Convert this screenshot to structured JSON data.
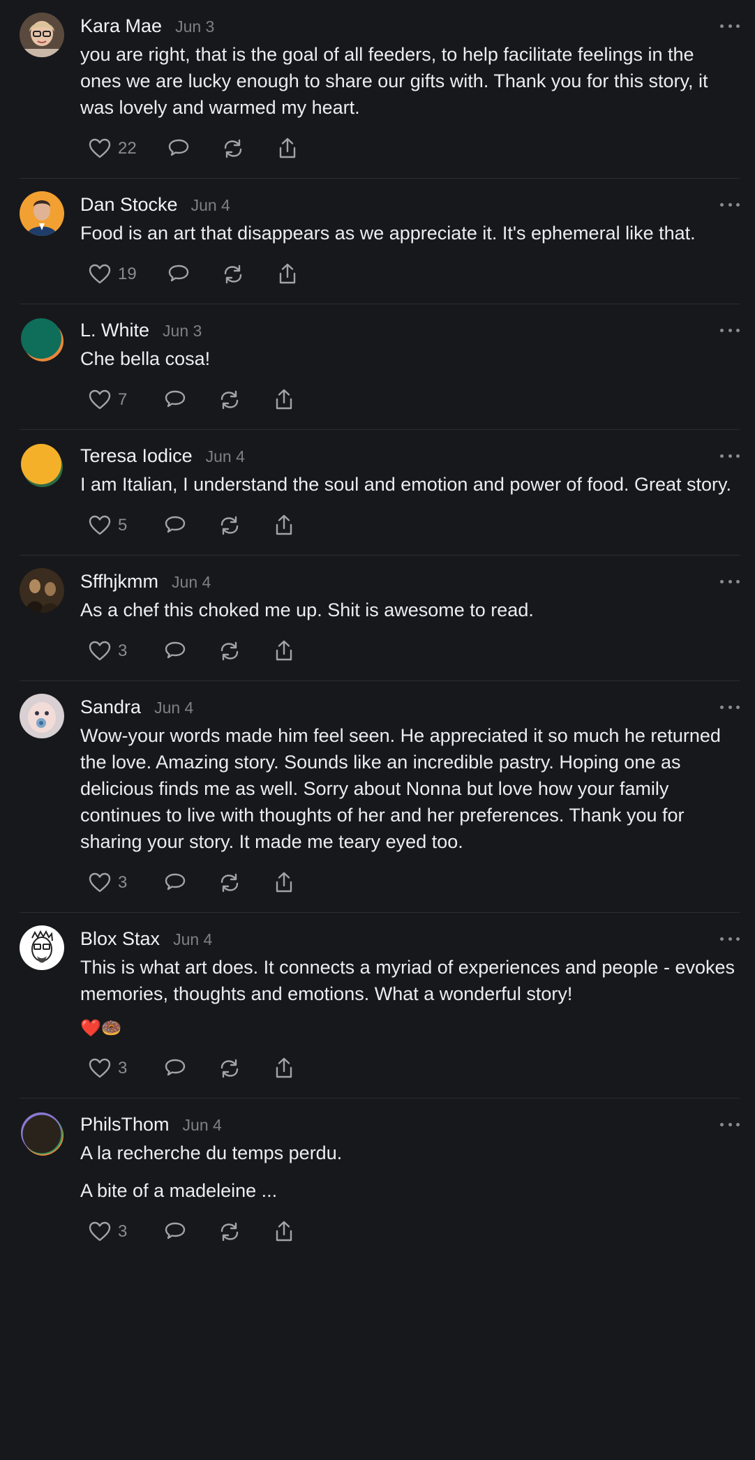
{
  "comments": [
    {
      "name": "Kara Mae",
      "date": "Jun 3",
      "paragraphs": [
        "you are right, that is the goal of all feeders, to help facilitate feelings in the ones we are lucky enough to share our gifts with. Thank you for this story, it was lovely and warmed my heart."
      ],
      "likes": "22",
      "avatar": "photo-woman-glasses"
    },
    {
      "name": "Dan Stocke",
      "date": "Jun 4",
      "paragraphs": [
        "Food is an art that disappears as we appreciate it. It's ephemeral like that."
      ],
      "likes": "19",
      "avatar": "photo-man-orange"
    },
    {
      "name": "L. White",
      "date": "Jun 3",
      "paragraphs": [
        "Che bella cosa!"
      ],
      "likes": "7",
      "avatar": "default-green"
    },
    {
      "name": "Teresa Iodice",
      "date": "Jun 4",
      "paragraphs": [
        "I am Italian, I understand the soul and emotion and power of food. Great story."
      ],
      "likes": "5",
      "avatar": "default-yellow"
    },
    {
      "name": "Sffhjkmm",
      "date": "Jun 4",
      "paragraphs": [
        "As a chef this choked me up. Shit is awesome to read."
      ],
      "likes": "3",
      "avatar": "photo-painting"
    },
    {
      "name": "Sandra",
      "date": "Jun 4",
      "paragraphs": [
        "Wow-your words made him feel seen. He appreciated it so much he returned the love. Amazing story. Sounds like an incredible pastry. Hoping one as delicious finds me as well. Sorry about Nonna but love how your family continues to live with thoughts of her and her preferences. Thank you for sharing your story. It made me teary eyed too."
      ],
      "likes": "3",
      "avatar": "photo-baby"
    },
    {
      "name": "Blox Stax",
      "date": "Jun 4",
      "paragraphs": [
        "This is what art does. It connects a myriad of experiences and people - evokes memories, thoughts and emotions. What a wonderful story!"
      ],
      "emoji": "❤️🍩",
      "likes": "3",
      "avatar": "drawing-face"
    },
    {
      "name": "PhilsThom",
      "date": "Jun 4",
      "paragraphs": [
        "A la recherche du temps perdu.",
        "A bite of a madeleine ..."
      ],
      "likes": "3",
      "avatar": "default-dark"
    }
  ],
  "icons": {
    "like": "heart-icon",
    "reply": "comment-bubble-icon",
    "repost": "repost-icon",
    "share": "share-icon",
    "more": "more-dots-icon"
  },
  "colors": {
    "background": "#17181b",
    "text": "#ecedef",
    "muted": "#7e8086",
    "divider": "#2c2d31"
  }
}
